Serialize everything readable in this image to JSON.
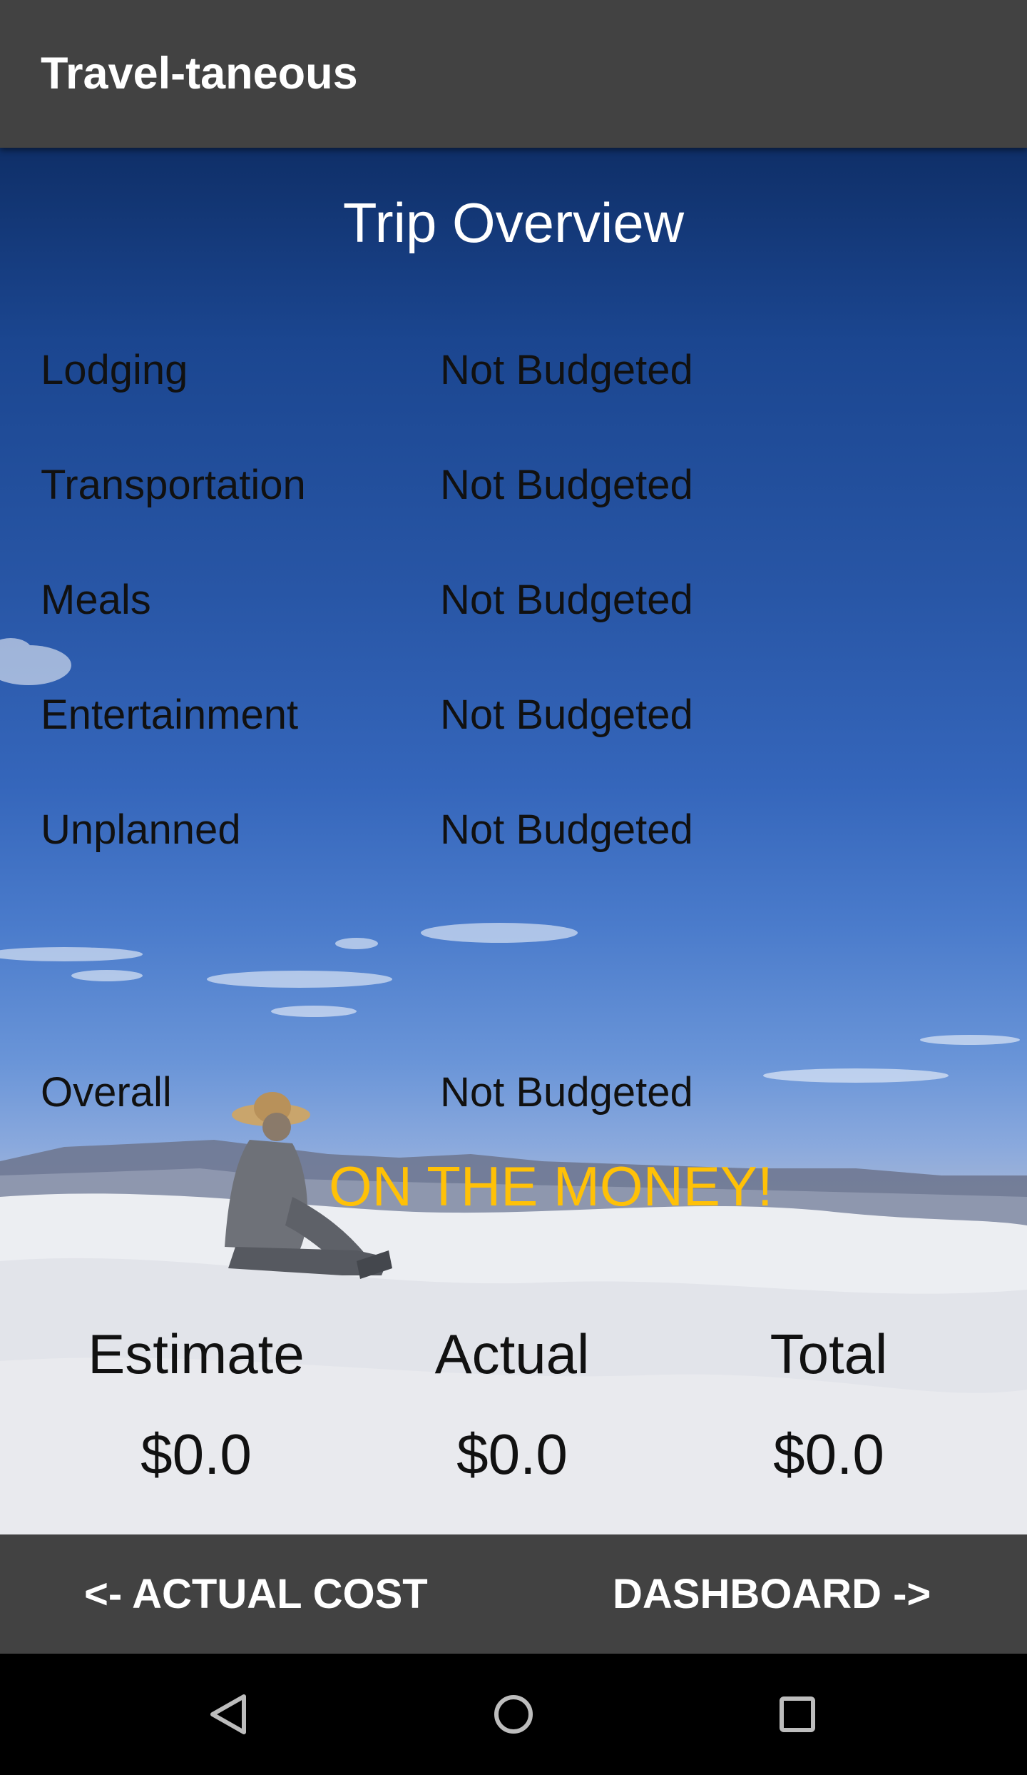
{
  "app": {
    "title": "Travel-taneous"
  },
  "overview": {
    "title": "Trip Overview",
    "rows": [
      {
        "label": "Lodging",
        "value": "Not Budgeted"
      },
      {
        "label": "Transportation",
        "value": "Not Budgeted"
      },
      {
        "label": "Meals",
        "value": "Not Budgeted"
      },
      {
        "label": "Entertainment",
        "value": "Not Budgeted"
      },
      {
        "label": "Unplanned",
        "value": "Not Budgeted"
      }
    ],
    "overall": {
      "label": "Overall",
      "value": "Not Budgeted"
    },
    "status": "ON THE MONEY!",
    "summary": {
      "estimate": {
        "label": "Estimate",
        "value": "$0.0"
      },
      "actual": {
        "label": "Actual",
        "value": "$0.0"
      },
      "total": {
        "label": "Total",
        "value": "$0.0"
      }
    }
  },
  "bottom_nav": {
    "left": "<- ACTUAL COST",
    "right": "DASHBOARD ->"
  },
  "system_nav": {
    "back_icon": "back-triangle-icon",
    "home_icon": "home-circle-icon",
    "recents_icon": "recents-square-icon"
  },
  "colors": {
    "app_bar": "#424242",
    "status_accent": "#ffc107",
    "text_dark": "#111111"
  }
}
